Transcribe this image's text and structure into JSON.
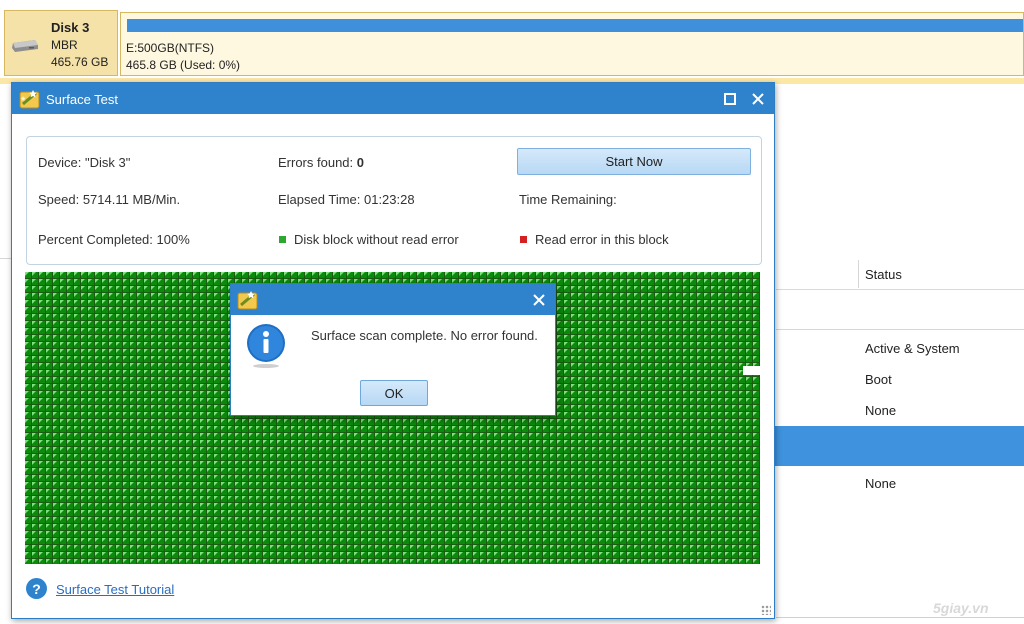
{
  "disk": {
    "name": "Disk 3",
    "type": "MBR",
    "size": "465.76 GB"
  },
  "partition": {
    "label": "E:500GB(NTFS)",
    "usage": "465.8 GB (Used: 0%)"
  },
  "table": {
    "status_header": "Status",
    "status_rows": [
      "Active & System",
      "Boot",
      "None",
      "",
      "None"
    ],
    "selected_row_index": 3
  },
  "surface_test": {
    "title": "Surface Test",
    "device": "Device: \"Disk 3\"",
    "errors_label": "Errors found:",
    "errors_value": "0",
    "start_button": "Start Now",
    "speed": "Speed:  5714.11 MB/Min.",
    "elapsed": "Elapsed Time:  01:23:28",
    "remaining": "Time Remaining:",
    "percent": "Percent Completed:  100%",
    "legend_ok": "Disk block without read error",
    "legend_error": "Read error in this block",
    "legend_ok_color": "#2da82d",
    "legend_error_color": "#d42020",
    "tutorial_link": "Surface Test Tutorial"
  },
  "message_box": {
    "text": "Surface scan complete. No error found.",
    "ok_button": "OK",
    "icon": "info-icon"
  },
  "watermark": "5giay.vn",
  "colors": {
    "title_bar": "#2e83cc",
    "accent": "#3f8fdb",
    "disk_card": "#f4e2a8"
  }
}
